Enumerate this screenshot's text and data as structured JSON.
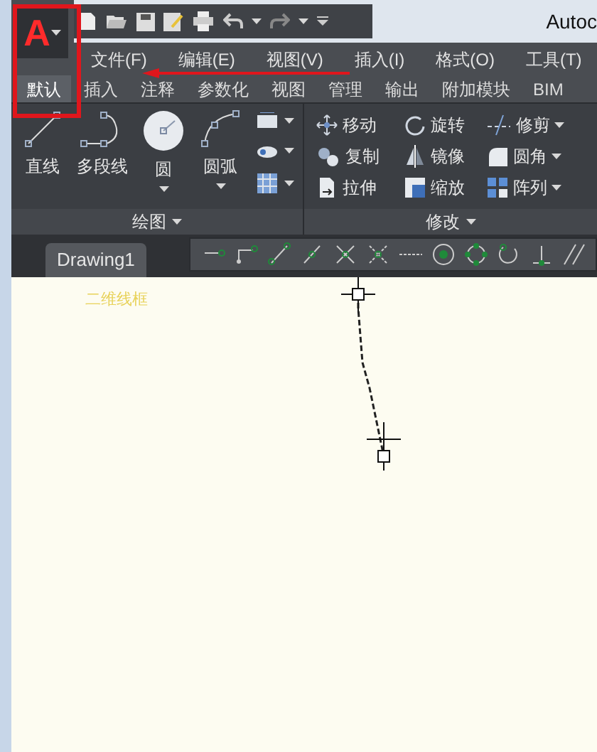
{
  "app_button": {
    "letter": "A"
  },
  "title": "Autoc",
  "menu": [
    "文件(F)",
    "编辑(E)",
    "视图(V)",
    "插入(I)",
    "格式(O)",
    "工具(T)"
  ],
  "ribbon_tabs": [
    {
      "label": "默认",
      "selected": true
    },
    {
      "label": "插入",
      "selected": false
    },
    {
      "label": "注释",
      "selected": false
    },
    {
      "label": "参数化",
      "selected": false
    },
    {
      "label": "视图",
      "selected": false
    },
    {
      "label": "管理",
      "selected": false
    },
    {
      "label": "输出",
      "selected": false
    },
    {
      "label": "附加模块",
      "selected": false
    },
    {
      "label": "BIM",
      "selected": false
    }
  ],
  "draw_panel": {
    "title": "绘图",
    "tools": [
      {
        "label": "直线",
        "kind": "line",
        "dropdown": false
      },
      {
        "label": "多段线",
        "kind": "polyline",
        "dropdown": false
      },
      {
        "label": "圆",
        "kind": "circle",
        "dropdown": true
      },
      {
        "label": "圆弧",
        "kind": "arc",
        "dropdown": true
      }
    ]
  },
  "modify_panel": {
    "title": "修改",
    "tools": [
      {
        "label": "移动",
        "kind": "move",
        "dropdown": false
      },
      {
        "label": "旋转",
        "kind": "rotate",
        "dropdown": false
      },
      {
        "label": "修剪",
        "kind": "trim",
        "dropdown": true
      },
      {
        "label": "复制",
        "kind": "copy",
        "dropdown": false
      },
      {
        "label": "镜像",
        "kind": "mirror",
        "dropdown": false
      },
      {
        "label": "圆角",
        "kind": "fillet",
        "dropdown": true
      },
      {
        "label": "拉伸",
        "kind": "stretch",
        "dropdown": false
      },
      {
        "label": "缩放",
        "kind": "scale",
        "dropdown": false
      },
      {
        "label": "阵列",
        "kind": "array",
        "dropdown": true
      }
    ]
  },
  "doc_tab": "Drawing1",
  "viewport_label": "二维线框"
}
